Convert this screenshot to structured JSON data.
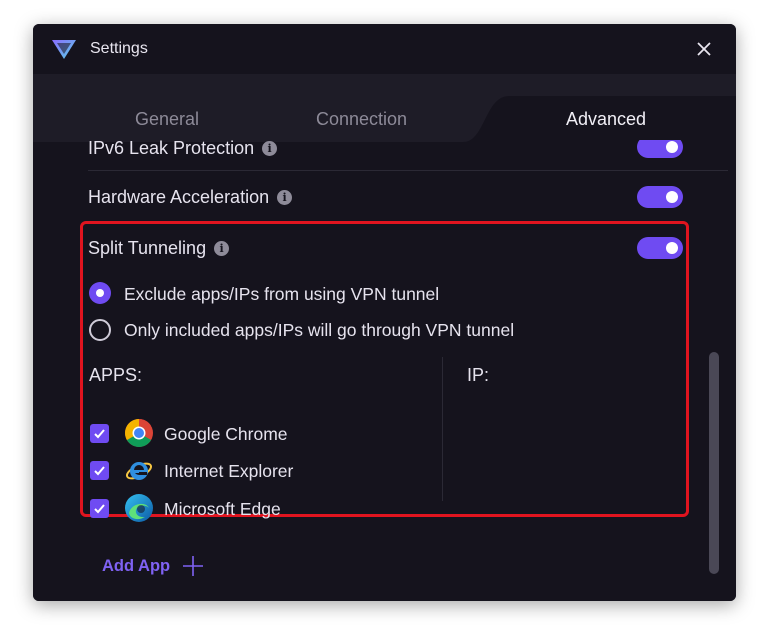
{
  "window": {
    "title": "Settings",
    "close_glyph": "✕",
    "logo_icon": "vpn-logo-icon"
  },
  "tabs": [
    {
      "label": "General",
      "active": false
    },
    {
      "label": "Connection",
      "active": false
    },
    {
      "label": "Advanced",
      "active": true
    }
  ],
  "settings": {
    "ipv6": {
      "label": "IPv6 Leak Protection",
      "enabled": true
    },
    "hardware": {
      "label": "Hardware Acceleration",
      "enabled": true
    },
    "split": {
      "label": "Split Tunneling",
      "enabled": true,
      "options": [
        {
          "label": "Exclude apps/IPs from using VPN tunnel",
          "selected": true
        },
        {
          "label": "Only included apps/IPs will go through VPN tunnel",
          "selected": false
        }
      ],
      "apps_heading": "APPS:",
      "ip_heading": "IP:",
      "apps": [
        {
          "name": "Google Chrome",
          "checked": true,
          "icon": "chrome-icon"
        },
        {
          "name": "Internet Explorer",
          "checked": true,
          "icon": "internet-explorer-icon"
        },
        {
          "name": "Microsoft Edge",
          "checked": true,
          "icon": "microsoft-edge-icon"
        }
      ]
    },
    "add_app_label": "Add App",
    "info_glyph": "i"
  },
  "colors": {
    "accent": "#6f4bf2",
    "window_bg": "#15131d",
    "tab_bg": "#1e1c27",
    "highlight_border": "#e0141f",
    "link": "#7f62f3"
  }
}
